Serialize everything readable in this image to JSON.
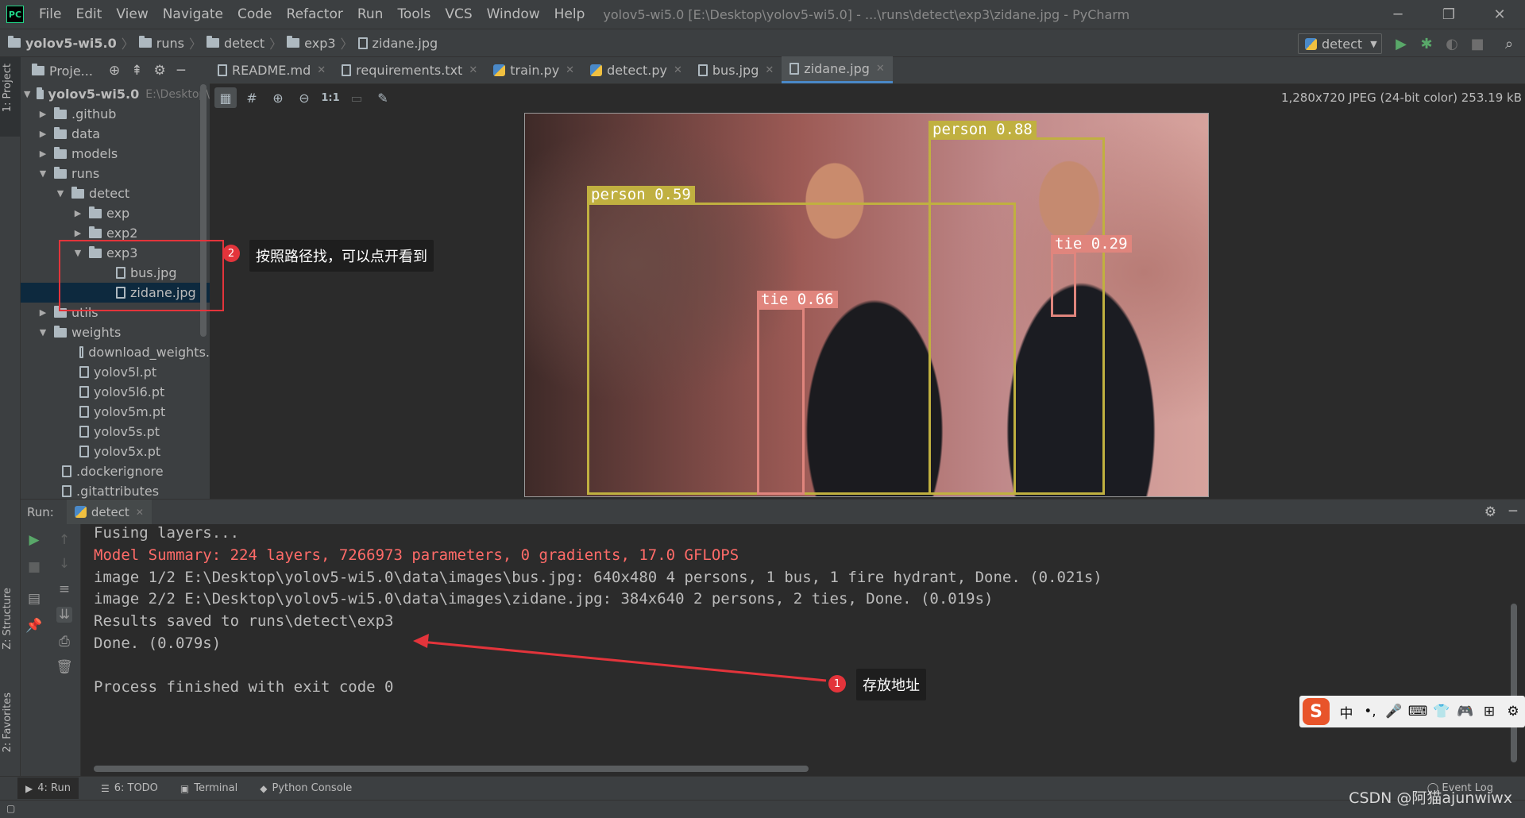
{
  "menubar": {
    "logo": "PC",
    "items": [
      "File",
      "Edit",
      "View",
      "Navigate",
      "Code",
      "Refactor",
      "Run",
      "Tools",
      "VCS",
      "Window",
      "Help"
    ],
    "title": "yolov5-wi5.0 [E:\\Desktop\\yolov5-wi5.0] - ...\\runs\\detect\\exp3\\zidane.jpg - PyCharm"
  },
  "navbar": {
    "crumbs": [
      "yolov5-wi5.0",
      "runs",
      "detect",
      "exp3",
      "zidane.jpg"
    ],
    "run_config": "detect"
  },
  "stripe": {
    "project": "1: Project",
    "structure": "Z: Structure",
    "favorites": "2: Favorites"
  },
  "project": {
    "header": "Proje...",
    "root_name": "yolov5-wi5.0",
    "root_path": "E:\\Desktop\\",
    "items": [
      ".github",
      "data",
      "models",
      "runs",
      "detect",
      "exp",
      "exp2",
      "exp3",
      "bus.jpg",
      "zidane.jpg",
      "utils",
      "weights",
      "download_weights.",
      "yolov5l.pt",
      "yolov5l6.pt",
      "yolov5m.pt",
      "yolov5s.pt",
      "yolov5x.pt",
      ".dockerignore",
      ".gitattributes"
    ]
  },
  "editor": {
    "tabs": [
      "README.md",
      "requirements.txt",
      "train.py",
      "detect.py",
      "bus.jpg",
      "zidane.jpg"
    ],
    "active_tab": "zidane.jpg",
    "image_info": "1,280x720 JPEG (24-bit color) 253.19 kB",
    "zoom_actual": "1:1",
    "detections": [
      {
        "label": "person 0.88",
        "class": "person"
      },
      {
        "label": "person 0.59",
        "class": "person"
      },
      {
        "label": "tie 0.29",
        "class": "tie"
      },
      {
        "label": "tie 0.66",
        "class": "tie"
      }
    ]
  },
  "annotations": {
    "badge1": "1",
    "note1": "存放地址",
    "badge2": "2",
    "note2": "按照路径找，可以点开看到",
    "color": "#e3343b"
  },
  "run": {
    "label": "Run:",
    "tab": "detect",
    "console": [
      "Fusing layers...",
      "Model Summary: 224 layers, 7266973 parameters, 0 gradients, 17.0 GFLOPS",
      "image 1/2 E:\\Desktop\\yolov5-wi5.0\\data\\images\\bus.jpg: 640x480 4 persons, 1 bus, 1 fire hydrant, Done. (0.021s)",
      "image 2/2 E:\\Desktop\\yolov5-wi5.0\\data\\images\\zidane.jpg: 384x640 2 persons, 2 ties, Done. (0.019s)",
      "Results saved to runs\\detect\\exp3",
      "Done. (0.079s)",
      "Process finished with exit code 0"
    ]
  },
  "ime": {
    "logo": "S",
    "items": [
      "中",
      "•,",
      "🎤",
      "⌨",
      "👕",
      "🎮",
      "⊞",
      "⚙"
    ]
  },
  "bottombar": {
    "tabs": [
      "4: Run",
      "6: TODO",
      "Terminal",
      "Python Console"
    ],
    "event_log": "Event Log"
  },
  "watermark": "CSDN @阿猫ajunwiwx",
  "colors": {
    "accent": "#4a88c7",
    "error_text": "#ff6b68",
    "box_person": "#c0b040",
    "box_tie": "#e0857d"
  }
}
